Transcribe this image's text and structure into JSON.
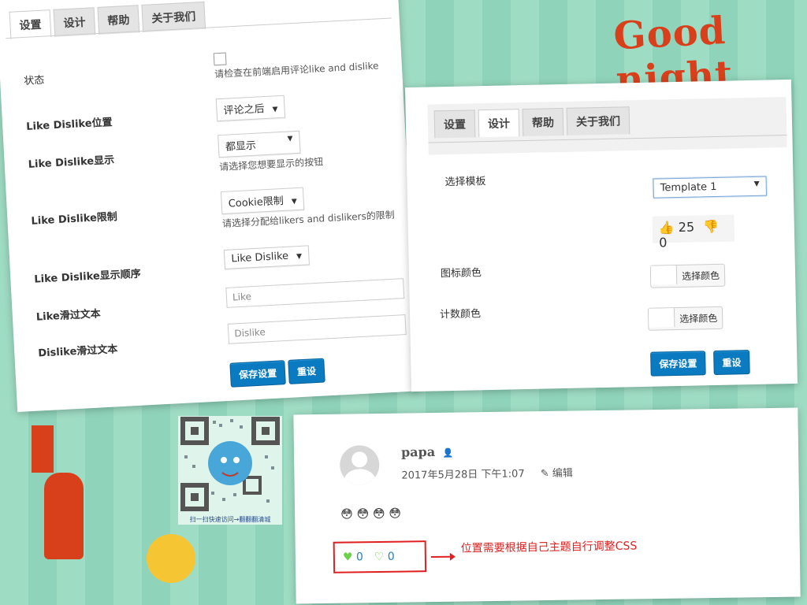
{
  "decor": {
    "goodnight": "Good night",
    "qr_caption": "扫一扫快速访问→翻翻翻清城"
  },
  "settings_panel": {
    "tabs": [
      "设置",
      "设计",
      "帮助",
      "关于我们"
    ],
    "status_label": "状态",
    "status_hint": "请检查在前端启用评论like and dislike",
    "position_label": "Like Dislike位置",
    "position_value": "评论之后",
    "display_label": "Like Dislike显示",
    "display_value": "都显示",
    "display_hint": "请选择您想要显示的按钮",
    "limit_label": "Like Dislike限制",
    "limit_value": "Cookie限制",
    "limit_hint": "请选择分配给likers and dislikers的限制",
    "order_label": "Like Dislike显示顺序",
    "order_value": "Like Dislike",
    "like_hover_label": "Like滑过文本",
    "like_hover_placeholder": "Like",
    "dislike_hover_label": "Dislike滑过文本",
    "dislike_hover_placeholder": "Dislike",
    "save_button": "保存设置",
    "reset_button": "重设"
  },
  "design_panel": {
    "tabs": [
      "设置",
      "设计",
      "帮助",
      "关于我们"
    ],
    "template_label": "选择模板",
    "template_value": "Template 1",
    "preview_like_count": "25",
    "preview_dislike_count": "0",
    "icon_color_label": "图标颜色",
    "count_color_label": "计数颜色",
    "pick_color": "选择颜色",
    "save_button": "保存设置",
    "reset_button": "重设"
  },
  "comment": {
    "author": "papa",
    "date": "2017年5月28日 下午1:07",
    "edit": "编辑",
    "emojis": "😳 😳 😳 😳",
    "like_count": "0",
    "dislike_count": "0",
    "note": "位置需要根据自己主题自行调整CSS"
  },
  "colors": {
    "accent_button": "#0b7bc1",
    "like_icon": "#6bd04a",
    "annotation_red": "#e02020"
  }
}
